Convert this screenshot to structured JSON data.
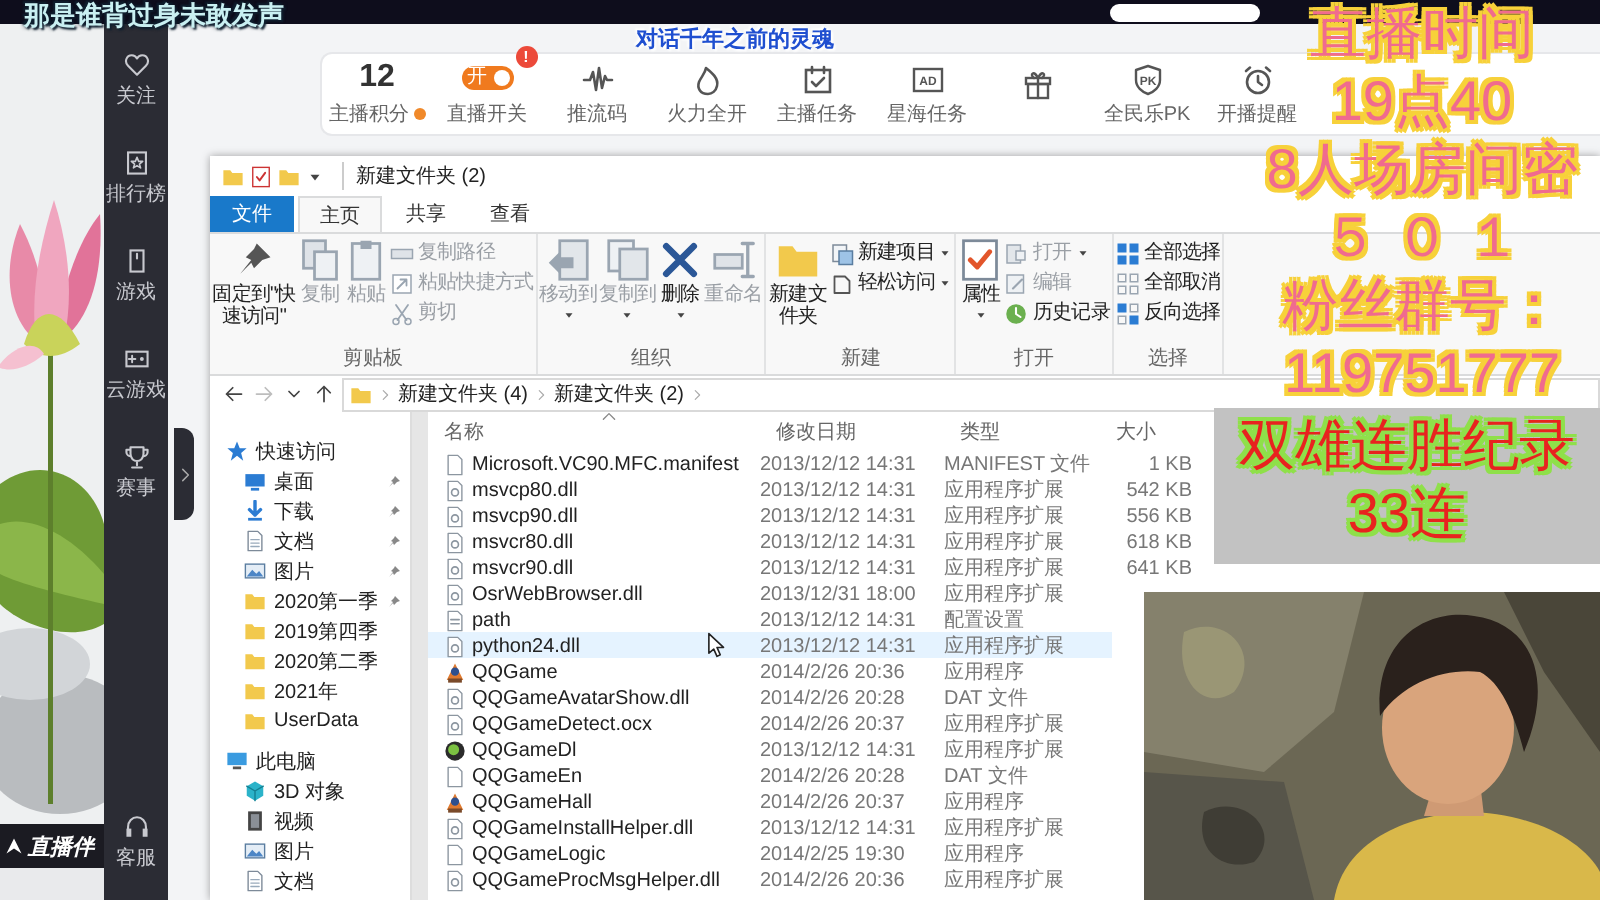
{
  "subtitle": "那是谁背过身未敢发声",
  "caption": "对话千年之前的灵魂",
  "sidebar": {
    "items": [
      "关注",
      "排行榜",
      "游戏",
      "云游戏",
      "赛事"
    ],
    "footer": "客服"
  },
  "brand": "直播伴",
  "stats": [
    {
      "kind": "score",
      "value": "12",
      "label": "主播积分"
    },
    {
      "kind": "toggle",
      "label": "直播开关",
      "toggle": "开",
      "on": true,
      "badge": "!"
    },
    {
      "kind": "action",
      "label": "推流码"
    },
    {
      "kind": "action",
      "label": "火力全开"
    },
    {
      "kind": "action",
      "label": "主播任务"
    },
    {
      "kind": "action",
      "label": "星海任务",
      "icon_text": "AD"
    },
    {
      "kind": "action"
    },
    {
      "kind": "action",
      "label": "全民乐PK",
      "icon_text": "PK"
    },
    {
      "kind": "action",
      "label": "开播提醒"
    }
  ],
  "explorer": {
    "title": "新建文件夹 (2)",
    "tabs": [
      {
        "label": "文件",
        "kind": "menu",
        "selected": false
      },
      {
        "label": "主页",
        "kind": "tab",
        "selected": true
      },
      {
        "label": "共享",
        "kind": "tab",
        "selected": false
      },
      {
        "label": "查看",
        "kind": "tab",
        "selected": false
      }
    ],
    "ribbon": [
      {
        "label": "剪贴板",
        "commands": [
          {
            "label": "固定到\"快速访问\"",
            "kind": "large",
            "disabled": false,
            "dropdown": false
          },
          {
            "label": "复制",
            "kind": "large",
            "disabled": true,
            "dropdown": false
          },
          {
            "label": "粘贴",
            "kind": "large",
            "disabled": true,
            "dropdown": false
          },
          {
            "label": "复制路径",
            "kind": "small",
            "disabled": true,
            "dropdown": false
          },
          {
            "label": "粘贴快捷方式",
            "kind": "small",
            "disabled": true,
            "dropdown": false
          },
          {
            "label": "剪切",
            "kind": "small",
            "disabled": true,
            "dropdown": false
          }
        ]
      },
      {
        "label": "组织",
        "commands": [
          {
            "label": "移动到",
            "kind": "large",
            "disabled": true,
            "dropdown": true
          },
          {
            "label": "复制到",
            "kind": "large",
            "disabled": true,
            "dropdown": true
          },
          {
            "label": "删除",
            "kind": "large",
            "disabled": false,
            "dropdown": true
          },
          {
            "label": "重命名",
            "kind": "large",
            "disabled": true,
            "dropdown": false
          }
        ]
      },
      {
        "label": "新建",
        "commands": [
          {
            "label": "新建文件夹",
            "kind": "large",
            "disabled": false,
            "dropdown": false
          },
          {
            "label": "新建项目",
            "kind": "small",
            "disabled": false,
            "dropdown": true
          },
          {
            "label": "轻松访问",
            "kind": "small",
            "disabled": false,
            "dropdown": true
          }
        ]
      },
      {
        "label": "打开",
        "commands": [
          {
            "label": "属性",
            "kind": "large",
            "disabled": false,
            "dropdown": true
          },
          {
            "label": "打开",
            "kind": "small",
            "disabled": true,
            "dropdown": true
          },
          {
            "label": "编辑",
            "kind": "small",
            "disabled": true,
            "dropdown": false
          },
          {
            "label": "历史记录",
            "kind": "small",
            "disabled": false,
            "dropdown": false
          }
        ]
      },
      {
        "label": "选择",
        "commands": [
          {
            "label": "全部选择",
            "kind": "small",
            "disabled": false,
            "dropdown": false
          },
          {
            "label": "全部取消",
            "kind": "small",
            "disabled": false,
            "dropdown": false
          },
          {
            "label": "反向选择",
            "kind": "small",
            "disabled": false,
            "dropdown": false
          }
        ]
      }
    ],
    "nav_buttons": [
      {
        "kind": "back",
        "disabled": false
      },
      {
        "kind": "forward",
        "disabled": true
      },
      {
        "kind": "recent",
        "disabled": false
      },
      {
        "kind": "up",
        "disabled": false
      }
    ],
    "path": [
      "新建文件夹 (4)",
      "新建文件夹 (2)"
    ],
    "nav": [
      {
        "label": "快速访问",
        "children": [
          {
            "label": "桌面",
            "pinned": true
          },
          {
            "label": "下载",
            "pinned": true
          },
          {
            "label": "文档",
            "pinned": true
          },
          {
            "label": "图片",
            "pinned": true
          },
          {
            "label": "2020第一季",
            "pinned": true
          },
          {
            "label": "2019第四季",
            "pinned": false
          },
          {
            "label": "2020第二季",
            "pinned": false
          },
          {
            "label": "2021年",
            "pinned": false
          },
          {
            "label": "UserData",
            "pinned": false
          }
        ]
      },
      {
        "label": "此电脑",
        "children": [
          {
            "label": "3D 对象",
            "pinned": false
          },
          {
            "label": "视频",
            "pinned": false
          },
          {
            "label": "图片",
            "pinned": false
          },
          {
            "label": "文档",
            "pinned": false
          }
        ]
      }
    ],
    "columns": [
      "名称",
      "修改日期",
      "类型",
      "大小"
    ],
    "files": [
      {
        "name": "Microsoft.VC90.MFC.manifest",
        "date": "2013/12/12 14:31",
        "type": "MANIFEST 文件",
        "size": "1 KB",
        "kind": "plain",
        "selected": false
      },
      {
        "name": "msvcp80.dll",
        "date": "2013/12/12 14:31",
        "type": "应用程序扩展",
        "size": "542 KB",
        "kind": "library",
        "selected": false
      },
      {
        "name": "msvcp90.dll",
        "date": "2013/12/12 14:31",
        "type": "应用程序扩展",
        "size": "556 KB",
        "kind": "library",
        "selected": false
      },
      {
        "name": "msvcr80.dll",
        "date": "2013/12/12 14:31",
        "type": "应用程序扩展",
        "size": "618 KB",
        "kind": "library",
        "selected": false
      },
      {
        "name": "msvcr90.dll",
        "date": "2013/12/12 14:31",
        "type": "应用程序扩展",
        "size": "641 KB",
        "kind": "library",
        "selected": false
      },
      {
        "name": "OsrWebBrowser.dll",
        "date": "2013/12/31 18:00",
        "type": "应用程序扩展",
        "kind": "library",
        "selected": false
      },
      {
        "name": "path",
        "date": "2013/12/12 14:31",
        "type": "配置设置",
        "kind": "config",
        "selected": false
      },
      {
        "name": "python24.dll",
        "date": "2013/12/12 14:31",
        "type": "应用程序扩展",
        "kind": "library",
        "selected": true
      },
      {
        "name": "QQGame",
        "date": "2014/2/26 20:36",
        "type": "应用程序",
        "kind": "game",
        "selected": false
      },
      {
        "name": "QQGameAvatarShow.dll",
        "date": "2014/2/26 20:28",
        "type": "DAT 文件",
        "kind": "library",
        "selected": false
      },
      {
        "name": "QQGameDetect.ocx",
        "date": "2014/2/26 20:37",
        "type": "应用程序扩展",
        "kind": "library",
        "selected": false
      },
      {
        "name": "QQGameDl",
        "date": "2013/12/12 14:31",
        "type": "应用程序扩展",
        "kind": "installer",
        "selected": false
      },
      {
        "name": "QQGameEn",
        "date": "2014/2/26 20:28",
        "type": "DAT 文件",
        "kind": "plain",
        "selected": false
      },
      {
        "name": "QQGameHall",
        "date": "2014/2/26 20:37",
        "type": "应用程序",
        "kind": "game",
        "selected": false
      },
      {
        "name": "QQGameInstallHelper.dll",
        "date": "2013/12/12 14:31",
        "type": "应用程序扩展",
        "kind": "library",
        "selected": false
      },
      {
        "name": "QQGameLogic",
        "date": "2014/2/25 19:30",
        "type": "应用程序",
        "kind": "plain",
        "selected": false
      },
      {
        "name": "QQGameProcMsgHelper.dll",
        "date": "2014/2/26 20:36",
        "type": "应用程序扩展",
        "kind": "library",
        "selected": false
      }
    ]
  },
  "stream_info": [
    {
      "text": "直播时间",
      "kind": "info"
    },
    {
      "text": "19点40",
      "kind": "info"
    },
    {
      "text": "8人场房间密",
      "kind": "info"
    },
    {
      "text": "５ ０ １",
      "kind": "info"
    },
    {
      "text": "粉丝群号：",
      "kind": "info"
    },
    {
      "text": "119751777",
      "kind": "info"
    },
    {
      "text": "双雄连胜纪录",
      "kind": "record"
    },
    {
      "text": "33连",
      "kind": "record"
    }
  ]
}
